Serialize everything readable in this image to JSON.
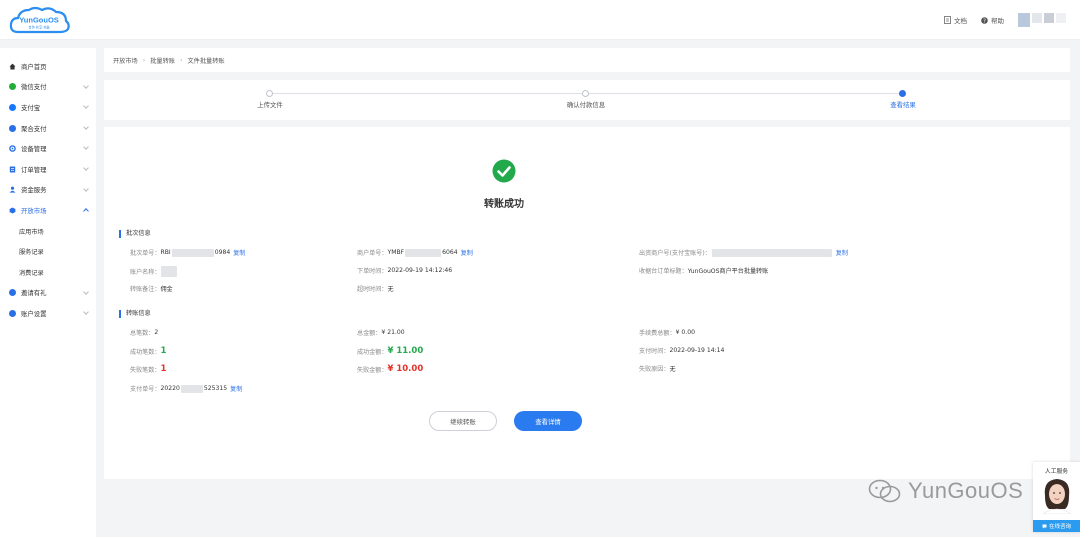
{
  "brand": {
    "logo_text": "YunGouOS",
    "logo_tagline": "合作·共享·共赢"
  },
  "header": {
    "docs_label": "文档",
    "help_label": "帮助"
  },
  "sidebar": {
    "items": [
      {
        "label": "商户首页",
        "icon": "home-icon",
        "color": "#333333"
      },
      {
        "label": "微信支付",
        "icon": "wechat-icon",
        "color": "#22ac38"
      },
      {
        "label": "支付宝",
        "icon": "alipay-icon",
        "color": "#1677ff"
      },
      {
        "label": "聚合支付",
        "icon": "aggregate-pay-icon",
        "color": "#2b6fe6"
      },
      {
        "label": "设备管理",
        "icon": "device-icon",
        "color": "#2b6fe6"
      },
      {
        "label": "订单管理",
        "icon": "order-icon",
        "color": "#2b6fe6"
      },
      {
        "label": "资金服务",
        "icon": "fund-icon",
        "color": "#2b6fe6"
      },
      {
        "label": "开放市场",
        "icon": "market-icon",
        "color": "#2b6fe6"
      }
    ],
    "sub_items": [
      "应用市场",
      "服务记录",
      "消费记录"
    ],
    "bottom_items": [
      {
        "label": "邀请有礼",
        "icon": "gift-icon",
        "color": "#2b6fe6"
      },
      {
        "label": "账户设置",
        "icon": "account-settings-icon",
        "color": "#2b6fe6"
      }
    ]
  },
  "breadcrumb": [
    "开放市场",
    "批量转账",
    "文件批量转账"
  ],
  "steps": [
    "上传文件",
    "确认付款信息",
    "查看结果"
  ],
  "result": {
    "title": "转账成功"
  },
  "batch_section": {
    "title": "批次信息",
    "batch_no_label": "批次单号：",
    "batch_no_prefix": "RBI",
    "batch_no_suffix": "0984",
    "copy": "复制",
    "merchant_no_label": "商户单号：",
    "merchant_no_prefix": "YMBF",
    "merchant_no_suffix": "6064",
    "payer_label": "出资商户号(支付宝账号)：",
    "account_name_label": "账户名称：",
    "order_time_label": "下单时间：",
    "order_time": "2022-09-19 14:12:46",
    "bill_title_label": "收据台订单标题：",
    "bill_title": "YunGouOS商户平台批量转账",
    "remark_label": "转账备注：",
    "remark": "佣金",
    "timeout_label": "超时时间：",
    "timeout": "无"
  },
  "transfer_section": {
    "title": "转账信息",
    "total_count_label": "总笔数：",
    "total_count": "2",
    "total_amount_label": "总金额：",
    "total_amount": "¥ 21.00",
    "fee_label": "手续费总额：",
    "fee": "¥ 0.00",
    "success_count_label": "成功笔数：",
    "success_count": "1",
    "success_amount_label": "成功金额：",
    "success_amount": "¥ 11.00",
    "pay_time_label": "支付时间：",
    "pay_time": "2022-09-19 14:14",
    "fail_count_label": "失败笔数：",
    "fail_count": "1",
    "fail_amount_label": "失败金额：",
    "fail_amount": "¥ 10.00",
    "fail_reason_label": "失败原因：",
    "fail_reason": "无",
    "pay_no_label": "支付单号：",
    "pay_no_prefix": "20220",
    "pay_no_suffix": "525315"
  },
  "buttons": {
    "continue": "继续转账",
    "details": "查看详情"
  },
  "watermark": "YunGouOS",
  "customer_service": {
    "label": "人工服务",
    "button": "在线咨询"
  },
  "colors": {
    "accent": "#2b6fe6",
    "success": "#22a94b",
    "danger": "#e0322b"
  }
}
